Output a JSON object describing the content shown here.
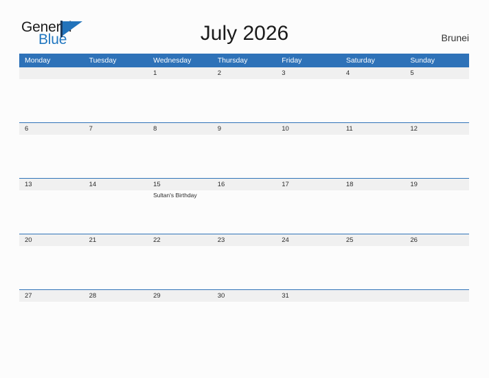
{
  "header": {
    "logo": {
      "text_top": "General",
      "text_bottom": "Blue",
      "icon": "flag-triangle-icon",
      "color_dark": "#1b1b1b",
      "color_blue": "#2177c0"
    },
    "title": "July 2026",
    "country": "Brunei"
  },
  "calendar": {
    "accent_color": "#2e72b8",
    "band_color": "#f0f0f0",
    "weekdays": [
      "Monday",
      "Tuesday",
      "Wednesday",
      "Thursday",
      "Friday",
      "Saturday",
      "Sunday"
    ],
    "weeks": [
      {
        "days": [
          {
            "date": "",
            "events": []
          },
          {
            "date": "",
            "events": []
          },
          {
            "date": "1",
            "events": []
          },
          {
            "date": "2",
            "events": []
          },
          {
            "date": "3",
            "events": []
          },
          {
            "date": "4",
            "events": []
          },
          {
            "date": "5",
            "events": []
          }
        ]
      },
      {
        "days": [
          {
            "date": "6",
            "events": []
          },
          {
            "date": "7",
            "events": []
          },
          {
            "date": "8",
            "events": []
          },
          {
            "date": "9",
            "events": []
          },
          {
            "date": "10",
            "events": []
          },
          {
            "date": "11",
            "events": []
          },
          {
            "date": "12",
            "events": []
          }
        ]
      },
      {
        "days": [
          {
            "date": "13",
            "events": []
          },
          {
            "date": "14",
            "events": []
          },
          {
            "date": "15",
            "events": [
              "Sultan's Birthday"
            ]
          },
          {
            "date": "16",
            "events": []
          },
          {
            "date": "17",
            "events": []
          },
          {
            "date": "18",
            "events": []
          },
          {
            "date": "19",
            "events": []
          }
        ]
      },
      {
        "days": [
          {
            "date": "20",
            "events": []
          },
          {
            "date": "21",
            "events": []
          },
          {
            "date": "22",
            "events": []
          },
          {
            "date": "23",
            "events": []
          },
          {
            "date": "24",
            "events": []
          },
          {
            "date": "25",
            "events": []
          },
          {
            "date": "26",
            "events": []
          }
        ]
      },
      {
        "days": [
          {
            "date": "27",
            "events": []
          },
          {
            "date": "28",
            "events": []
          },
          {
            "date": "29",
            "events": []
          },
          {
            "date": "30",
            "events": []
          },
          {
            "date": "31",
            "events": []
          },
          {
            "date": "",
            "events": []
          },
          {
            "date": "",
            "events": []
          }
        ]
      }
    ]
  }
}
